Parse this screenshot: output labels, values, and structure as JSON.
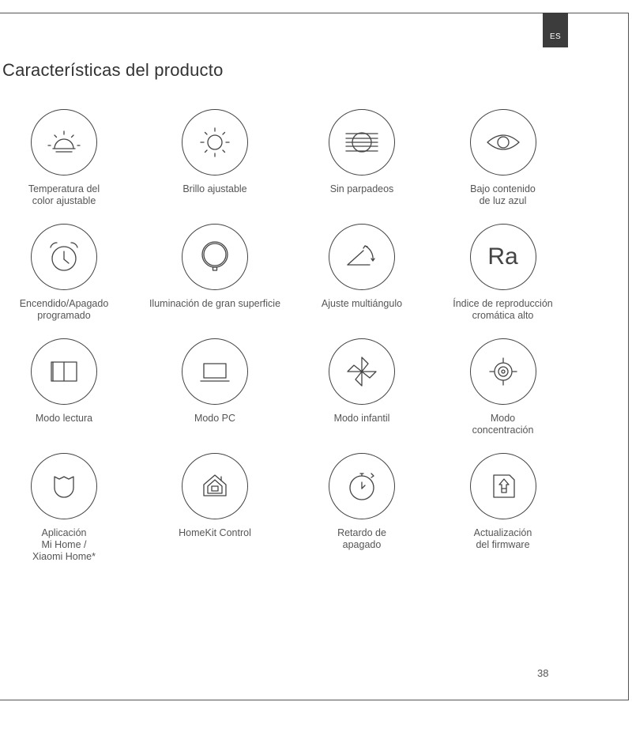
{
  "lang_tab": "ES",
  "title": "Características del producto",
  "features": [
    {
      "label": "Temperatura del\ncolor ajustable",
      "icon": "sunrise-icon"
    },
    {
      "label": "Brillo ajustable",
      "icon": "sun-icon"
    },
    {
      "label": "Sin parpadeos",
      "icon": "no-flicker-icon"
    },
    {
      "label": "Bajo contenido\nde luz azul",
      "icon": "eye-icon"
    },
    {
      "label": "Encendido/Apagado\nprogramado",
      "icon": "alarm-clock-icon"
    },
    {
      "label": "Iluminación de gran superficie",
      "icon": "lamp-head-icon"
    },
    {
      "label": "Ajuste multiángulo",
      "icon": "angle-icon"
    },
    {
      "label": "Índice de reproducción\ncromática alto",
      "icon": "ra-icon",
      "icon_text": "Ra"
    },
    {
      "label": "Modo lectura",
      "icon": "book-icon"
    },
    {
      "label": "Modo PC",
      "icon": "laptop-icon"
    },
    {
      "label": "Modo infantil",
      "icon": "pinwheel-icon"
    },
    {
      "label": "Modo\nconcentración",
      "icon": "target-icon"
    },
    {
      "label": "Aplicación\nMi Home /\nXiaomi Home*",
      "icon": "mi-home-icon"
    },
    {
      "label": "HomeKit Control",
      "icon": "homekit-icon"
    },
    {
      "label": "Retardo de\napagado",
      "icon": "timer-icon"
    },
    {
      "label": "Actualización\ndel firmware",
      "icon": "firmware-update-icon"
    }
  ],
  "page_number": "38"
}
